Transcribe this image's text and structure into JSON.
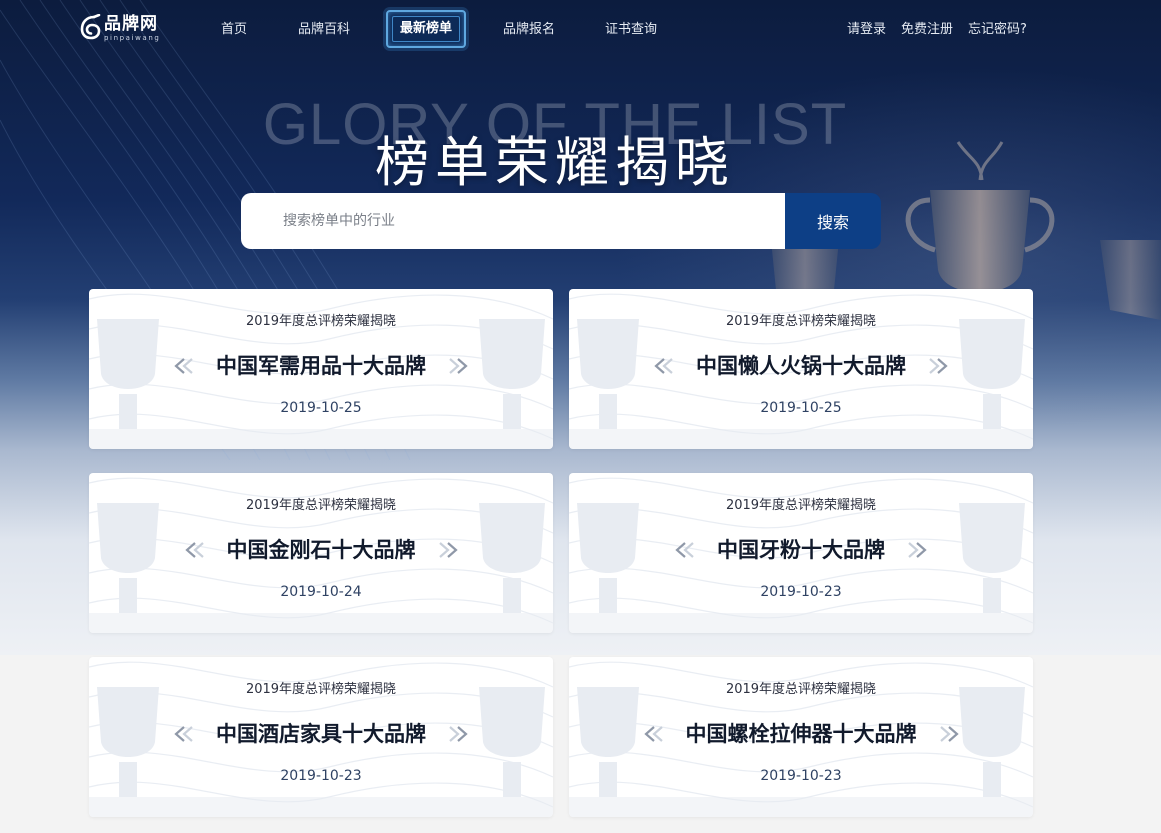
{
  "nav": {
    "logo_text": "品牌网",
    "logo_sub": "pinpaiwang",
    "items": [
      {
        "label": "首页"
      },
      {
        "label": "品牌百科"
      },
      {
        "label": "最新榜单"
      },
      {
        "label": "品牌报名"
      },
      {
        "label": "证书查询"
      }
    ],
    "active_index": 2,
    "login": "请登录",
    "register": "免费注册",
    "forgot": "忘记密码?"
  },
  "hero": {
    "en_title": "GLORY OF THE LIST",
    "cn_title": "榜单荣耀揭晓"
  },
  "search": {
    "placeholder": "搜索榜单中的行业",
    "value": "",
    "button_label": "搜索"
  },
  "cards": [
    {
      "subtitle": "2019年度总评榜荣耀揭晓",
      "title": "中国军需用品十大品牌",
      "date": "2019-10-25"
    },
    {
      "subtitle": "2019年度总评榜荣耀揭晓",
      "title": "中国懒人火锅十大品牌",
      "date": "2019-10-25"
    },
    {
      "subtitle": "2019年度总评榜荣耀揭晓",
      "title": "中国金刚石十大品牌",
      "date": "2019-10-24"
    },
    {
      "subtitle": "2019年度总评榜荣耀揭晓",
      "title": "中国牙粉十大品牌",
      "date": "2019-10-23"
    },
    {
      "subtitle": "2019年度总评榜荣耀揭晓",
      "title": "中国酒店家具十大品牌",
      "date": "2019-10-23"
    },
    {
      "subtitle": "2019年度总评榜荣耀揭晓",
      "title": "中国螺栓拉伸器十大品牌",
      "date": "2019-10-23"
    }
  ],
  "icons": {
    "logo": "logo-icon",
    "left_decor": "chevron-double-left-icon",
    "right_decor": "chevron-double-right-icon",
    "card_watermark": "trophy-icon"
  },
  "colors": {
    "hero_top": "#0c1c3e",
    "search_button": "#0d3f86",
    "active_nav_border": "#5fa8e0",
    "card_title": "#111a2c",
    "card_date": "#2f4263"
  }
}
